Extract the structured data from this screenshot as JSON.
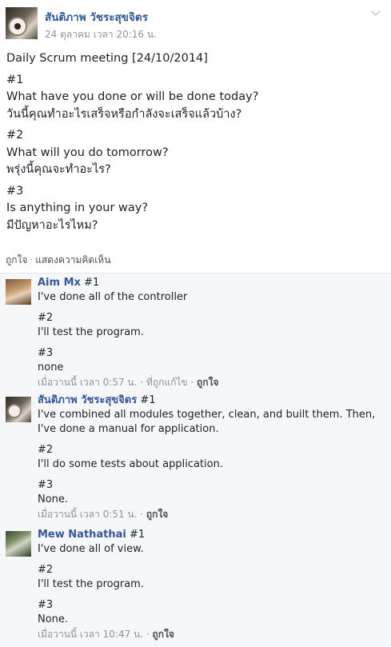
{
  "post": {
    "author": "สันติภาพ วัชระสุขจิตร",
    "time": "24 ตุลาคม เวลา 20:16 น.",
    "title": "Daily Scrum meeting [24/10/2014]",
    "q1_num": "#1",
    "q1_en": "What have you done or will be done today?",
    "q1_th": "วันนี้คุณทำอะไรเสร็จหรือกำลังจะเสร็จแล้วบ้าง?",
    "q2_num": "#2",
    "q2_en": "What will you do tomorrow?",
    "q2_th": "พรุ่งนี้คุณจะทำอะไร?",
    "q3_num": "#3",
    "q3_en": "Is anything in your way?",
    "q3_th": "มีปัญหาอะไรไหม?",
    "like_label": "ถูกใจ",
    "sep": "·",
    "comments_label": "แสดงความคิดเห็น"
  },
  "comments": [
    {
      "name": "Aim Mx",
      "line1_tag": " #1",
      "line1": "I've done all of the controller",
      "n2": "#2",
      "line2": "I'll test the program.",
      "n3": "#3",
      "line3": "none",
      "time": "เมื่อวานนี้ เวลา 0:57 น.",
      "edited": "ที่ถูกแก้ไข",
      "like": "ถูกใจ"
    },
    {
      "name": "สันติภาพ วัชระสุขจิตร",
      "line1_tag": " #1",
      "line1": "I've combined all modules together, clean, and built them. Then, I've done a manual for application.",
      "n2": "#2",
      "line2": "I'll do some tests about application.",
      "n3": "#3",
      "line3": "None.",
      "time": "เมื่อวานนี้ เวลา 0:51 น.",
      "like": "ถูกใจ"
    },
    {
      "name": "Mew Nathathai",
      "line1_tag": " #1",
      "line1": "I've done all of view.",
      "n2": "#2",
      "line2": "I'll test the program.",
      "n3": "#3",
      "line3": "None.",
      "time": "เมื่อวานนี้ เวลา 10:47 น.",
      "like": "ถูกใจ"
    }
  ],
  "icons": {
    "caret": "chevron-down-icon"
  },
  "colors": {
    "link": "#365899",
    "meta": "#90949c",
    "comment_bg": "#f6f7f9"
  }
}
